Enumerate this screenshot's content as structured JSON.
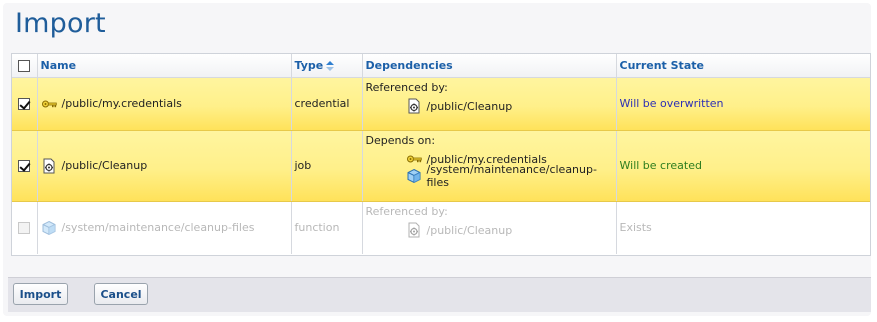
{
  "page": {
    "title": "Import"
  },
  "table": {
    "headers": {
      "name": "Name",
      "type": "Type",
      "dependencies": "Dependencies",
      "state": "Current State"
    },
    "rows": [
      {
        "checked": true,
        "name": "/public/my.credentials",
        "icon": "key-icon",
        "type": "credential",
        "dep_label": "Referenced by:",
        "deps": [
          {
            "icon": "job-icon",
            "path": "/public/Cleanup"
          }
        ],
        "state": "Will be overwritten"
      },
      {
        "checked": true,
        "name": "/public/Cleanup",
        "icon": "job-icon",
        "type": "job",
        "dep_label": "Depends on:",
        "deps": [
          {
            "icon": "key-icon",
            "path": "/public/my.credentials"
          },
          {
            "icon": "cube-icon",
            "path": "/system/maintenance/cleanup-files"
          }
        ],
        "state": "Will be created"
      },
      {
        "checked": false,
        "disabled": true,
        "name": "/system/maintenance/cleanup-files",
        "icon": "cube-icon",
        "type": "function",
        "dep_label": "Referenced by:",
        "deps": [
          {
            "icon": "job-icon",
            "path": "/public/Cleanup"
          }
        ],
        "state": "Exists"
      }
    ]
  },
  "footer": {
    "import_label": "Import",
    "cancel_label": "Cancel"
  },
  "colors": {
    "title": "#1f5d9a",
    "header_text": "#1b5fa8",
    "selected_row": "#fff08a",
    "state_overwrite": "#2d2fb5",
    "state_create": "#2e7d1e"
  }
}
